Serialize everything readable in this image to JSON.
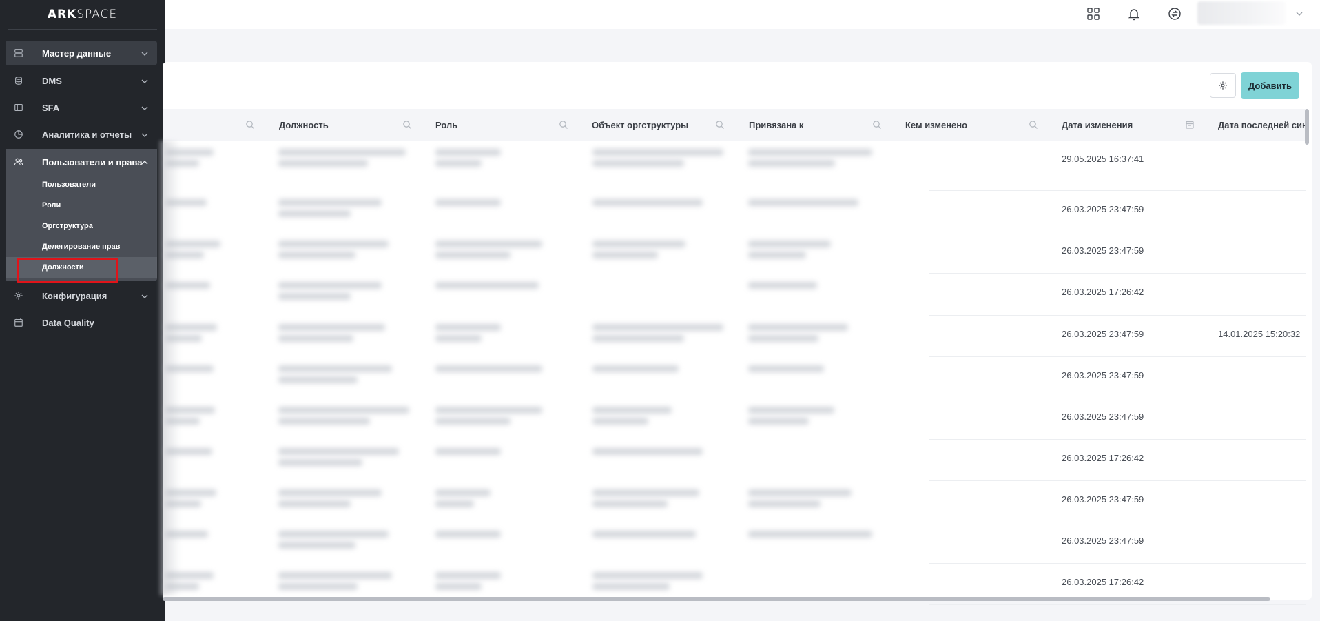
{
  "app": {
    "logo_bold": "ARK",
    "logo_light": "SPACE"
  },
  "sidebar": {
    "items": [
      {
        "label": "Мастер данные",
        "icon": "server-icon"
      },
      {
        "label": "DMS",
        "icon": "database-icon"
      },
      {
        "label": "SFA",
        "icon": "layout-icon"
      },
      {
        "label": "Аналитика и отчеты",
        "icon": "pie-chart-icon"
      }
    ],
    "group": {
      "label": "Пользователи и права",
      "icon": "users-icon",
      "subitems": [
        "Пользователи",
        "Роли",
        "Оргструктура",
        "Делегирование прав",
        "Должности"
      ]
    },
    "bottom_items": [
      {
        "label": "Конфигурация",
        "icon": "gear-icon"
      },
      {
        "label": "Data Quality",
        "icon": "calendar-icon"
      }
    ]
  },
  "toolbar": {
    "add_label": "Добавить"
  },
  "table": {
    "columns": [
      "Должность",
      "Роль",
      "Объект оргструктуры",
      "Привязана к",
      "Кем изменено",
      "Дата изменения",
      "Дата последней син"
    ],
    "rows": [
      {
        "changed": "29.05.2025 16:37:41",
        "synced": ""
      },
      {
        "changed": "26.03.2025 23:47:59",
        "synced": ""
      },
      {
        "changed": "26.03.2025 23:47:59",
        "synced": ""
      },
      {
        "changed": "26.03.2025 17:26:42",
        "synced": ""
      },
      {
        "changed": "26.03.2025 23:47:59",
        "synced": "14.01.2025 15:20:32"
      },
      {
        "changed": "26.03.2025 23:47:59",
        "synced": ""
      },
      {
        "changed": "26.03.2025 23:47:59",
        "synced": ""
      },
      {
        "changed": "26.03.2025 17:26:42",
        "synced": ""
      },
      {
        "changed": "26.03.2025 23:47:59",
        "synced": ""
      },
      {
        "changed": "26.03.2025 23:47:59",
        "synced": ""
      },
      {
        "changed": "26.03.2025 17:26:42",
        "synced": ""
      }
    ]
  },
  "colors": {
    "sidebar_bg": "#23262b",
    "accent": "#7fd3d6",
    "highlight_box": "#e0141a"
  }
}
